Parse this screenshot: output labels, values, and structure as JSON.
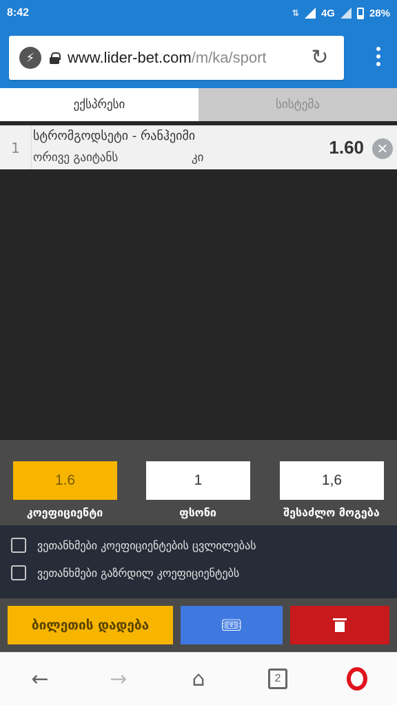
{
  "status_bar": {
    "time": "8:42",
    "network": "4G",
    "battery": "28%"
  },
  "browser": {
    "url_domain": "www.lider-bet.com",
    "url_path": "/m/ka/sport"
  },
  "tabs": [
    {
      "label": "ექსპრესი",
      "active": true
    },
    {
      "label": "სისტემა",
      "active": false
    }
  ],
  "bet": {
    "index": "1",
    "match": "სტრომგოდსეტი - რანჰეიმი",
    "market": "ორივე გაიტანს",
    "pick": "კი",
    "odds": "1.60"
  },
  "summary": {
    "coefficient_value": "1.6",
    "stake_value": "1",
    "possible_win_value": "1,6",
    "coefficient_label": "კოეფიციენტი",
    "stake_label": "ფსონი",
    "possible_win_label": "შესაძლო მოგება"
  },
  "options": {
    "accept_odds_change": "ვეთანხმები კოეფიციენტების ცვლილებას",
    "accept_increased_odds": "ვეთანხმები გაზრდილ კოეფიციენტებს"
  },
  "actions": {
    "place_bet_label": "ბილეთის დადება"
  },
  "bottom_nav": {
    "tabs_count": "2"
  },
  "colors": {
    "brand_blue": "#1f7fd3",
    "accent_yellow": "#f7b500",
    "delete_red": "#c8191c",
    "ticket_blue": "#3f79e0"
  }
}
